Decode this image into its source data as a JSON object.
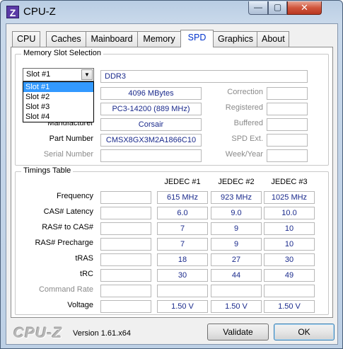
{
  "window": {
    "title": "CPU-Z",
    "icon_letter": "Z",
    "minimize": "—",
    "maximize": "▢",
    "close": "✕"
  },
  "tabs": [
    {
      "label": "CPU"
    },
    {
      "label": "Caches"
    },
    {
      "label": "Mainboard"
    },
    {
      "label": "Memory"
    },
    {
      "label": "SPD",
      "active": true
    },
    {
      "label": "Graphics"
    },
    {
      "label": "About"
    }
  ],
  "slot": {
    "group_title": "Memory Slot Selection",
    "selected": "Slot #1",
    "options": [
      "Slot #1",
      "Slot #2",
      "Slot #3",
      "Slot #4"
    ],
    "type": "DDR3",
    "module_size": "4096 MBytes",
    "max_bandwidth": "PC3-14200 (889 MHz)",
    "manufacturer_label": "Manufacturer",
    "manufacturer": "Corsair",
    "part_number_label": "Part Number",
    "part_number": "CMSX8GX3M2A1866C10",
    "serial_number_label": "Serial Number",
    "serial_number": "",
    "correction_label": "Correction",
    "registered_label": "Registered",
    "buffered_label": "Buffered",
    "spd_ext_label": "SPD Ext.",
    "week_year_label": "Week/Year"
  },
  "timings": {
    "group_title": "Timings Table",
    "columns": [
      "JEDEC #1",
      "JEDEC #2",
      "JEDEC #3"
    ],
    "rows": [
      {
        "label": "Frequency",
        "values": [
          "615 MHz",
          "923 MHz",
          "1025 MHz"
        ]
      },
      {
        "label": "CAS# Latency",
        "values": [
          "6.0",
          "9.0",
          "10.0"
        ]
      },
      {
        "label": "RAS# to CAS#",
        "values": [
          "7",
          "9",
          "10"
        ]
      },
      {
        "label": "RAS# Precharge",
        "values": [
          "7",
          "9",
          "10"
        ]
      },
      {
        "label": "tRAS",
        "values": [
          "18",
          "27",
          "30"
        ]
      },
      {
        "label": "tRC",
        "values": [
          "30",
          "44",
          "49"
        ]
      },
      {
        "label": "Command Rate",
        "values": [
          "",
          "",
          ""
        ],
        "dim": true
      },
      {
        "label": "Voltage",
        "values": [
          "1.50 V",
          "1.50 V",
          "1.50 V"
        ]
      }
    ]
  },
  "footer": {
    "logo": "CPU-Z",
    "version": "Version 1.61.x64",
    "validate_label": "Validate",
    "ok_label": "OK"
  }
}
